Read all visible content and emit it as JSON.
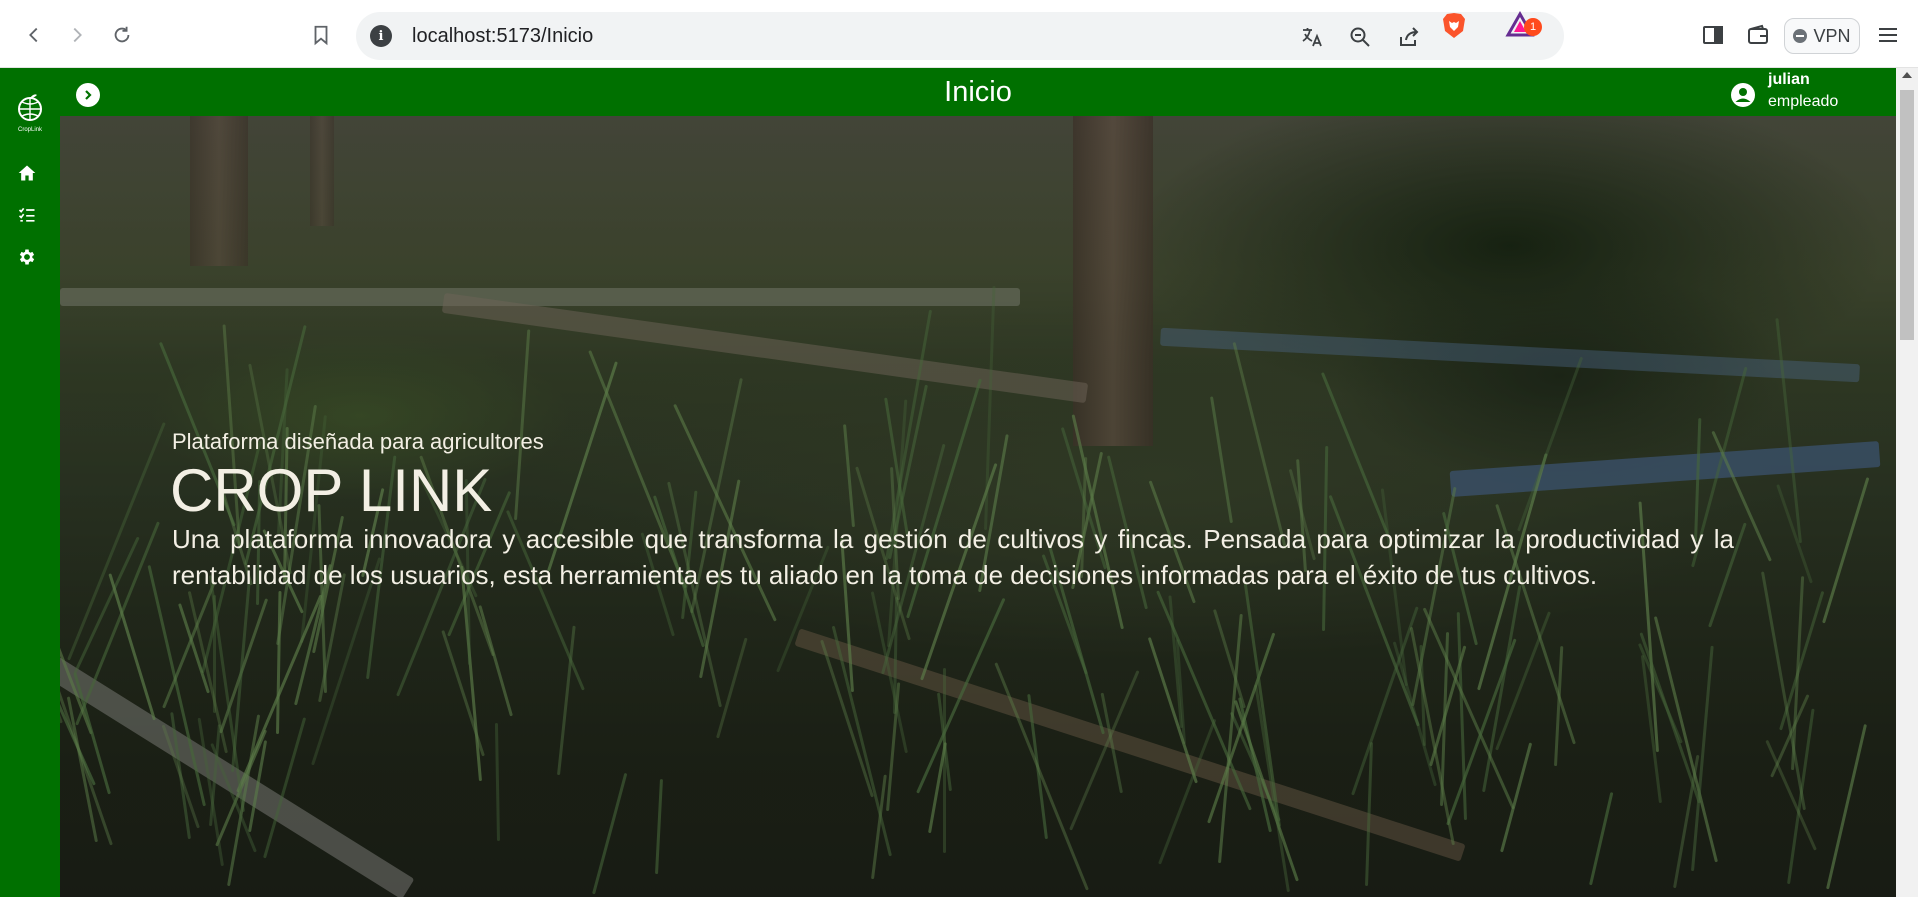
{
  "browser": {
    "url": "localhost:5173/Inicio",
    "info_glyph": "i",
    "rewards_count": "1",
    "vpn_label": "VPN"
  },
  "header": {
    "title": "Inicio",
    "user_name": "julian",
    "user_role": "empleado"
  },
  "logo": {
    "text": "CropLink"
  },
  "sidebar": {
    "items": [
      {
        "icon": "home-icon"
      },
      {
        "icon": "checklist-icon"
      },
      {
        "icon": "gear-icon"
      }
    ]
  },
  "hero": {
    "subtitle": "Plataforma diseñada para agricultores",
    "title": "CROP LINK",
    "description": "Una plataforma innovadora y accesible que transforma la gestión de cultivos y fincas. Pensada para optimizar la productividad y la rentabilidad de los usuarios, esta herramienta es tu aliado en la toma de decisiones informadas para el éxito de tus cultivos."
  },
  "colors": {
    "brand_green": "#007000",
    "hero_text": "#f3efe4"
  }
}
